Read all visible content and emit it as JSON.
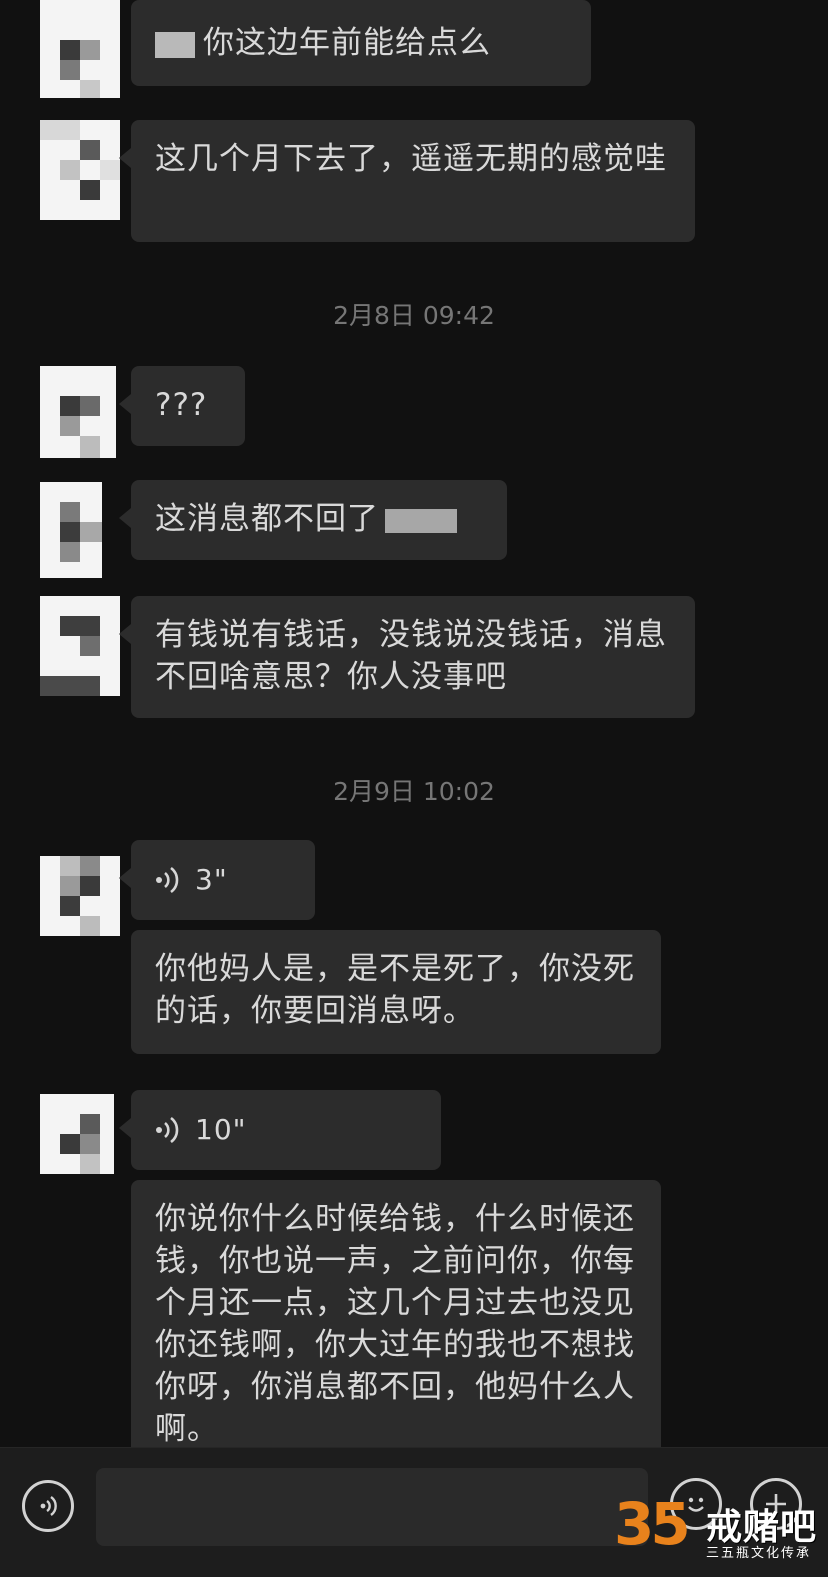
{
  "conversation": {
    "messages": [
      {
        "text": "你这边年前能给点么",
        "prefix_redacted": true
      },
      {
        "text": "这几个月下去了，遥遥无期的感觉哇"
      },
      {
        "text": "???"
      },
      {
        "text": "这消息都不回了",
        "suffix_redacted": true
      },
      {
        "text": "有钱说有钱话，没钱说没钱话，消息不回啥意思？你人没事吧"
      },
      {
        "voice_duration": "3\""
      },
      {
        "text": "你他妈人是，是不是死了，你没死的话，你要回消息呀。"
      },
      {
        "voice_duration": "10\""
      },
      {
        "text": "你说你什么时候给钱，什么时候还钱，你也说一声，之前问你，你每个月还一点，这几个月过去也没见你还钱啊，你大过年的我也不想找你呀，你消息都不回，他妈什么人啊。"
      }
    ],
    "timestamps": [
      "2月8日 09:42",
      "2月9日 10:02"
    ]
  },
  "input_bar": {
    "voice_icon": "voice-icon",
    "emoji_icon": "emoji-icon",
    "plus_icon": "plus-icon",
    "input_value": ""
  },
  "watermark": {
    "number": "35",
    "name": "戒赌吧",
    "subtitle": "三五瓶文化传承"
  },
  "colors": {
    "background": "#111111",
    "bubble": "#2c2c2c",
    "timestamp": "#767676",
    "watermark_orange": "#e8821c",
    "watermark_blue": "#1f86d8"
  }
}
